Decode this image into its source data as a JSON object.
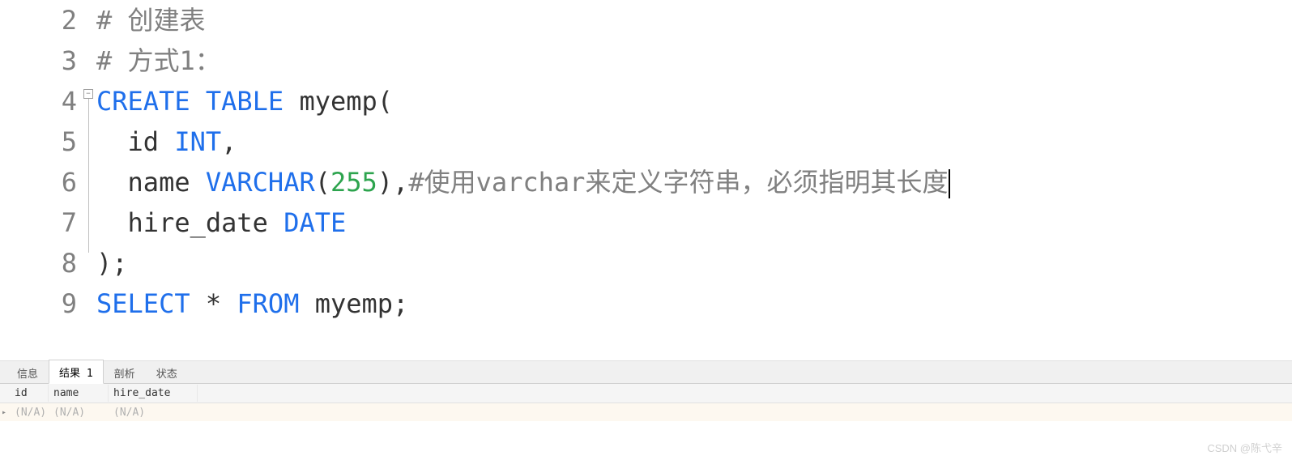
{
  "code": {
    "lines": [
      {
        "num": "2",
        "tokens": [
          {
            "cls": "tok-comment",
            "t": "# 创建表"
          }
        ]
      },
      {
        "num": "3",
        "tokens": [
          {
            "cls": "tok-comment",
            "t": "# 方式1："
          }
        ]
      },
      {
        "num": "4",
        "tokens": [
          {
            "cls": "tok-keyword",
            "t": "CREATE"
          },
          {
            "cls": "tok-punct",
            "t": " "
          },
          {
            "cls": "tok-keyword",
            "t": "TABLE"
          },
          {
            "cls": "tok-ident",
            "t": " myemp"
          },
          {
            "cls": "tok-punct",
            "t": "("
          }
        ]
      },
      {
        "num": "5",
        "tokens": [
          {
            "cls": "tok-punct",
            "t": "  "
          },
          {
            "cls": "tok-ident",
            "t": "id "
          },
          {
            "cls": "tok-keyword",
            "t": "INT"
          },
          {
            "cls": "tok-punct",
            "t": ","
          }
        ]
      },
      {
        "num": "6",
        "tokens": [
          {
            "cls": "tok-punct",
            "t": "  "
          },
          {
            "cls": "tok-ident",
            "t": "name "
          },
          {
            "cls": "tok-keyword",
            "t": "VARCHAR"
          },
          {
            "cls": "tok-punct",
            "t": "("
          },
          {
            "cls": "tok-number",
            "t": "255"
          },
          {
            "cls": "tok-punct",
            "t": "),"
          },
          {
            "cls": "tok-comment",
            "t": "#使用varchar来定义字符串，必须指明其长度"
          }
        ],
        "cursor": true
      },
      {
        "num": "7",
        "tokens": [
          {
            "cls": "tok-punct",
            "t": "  "
          },
          {
            "cls": "tok-ident",
            "t": "hire_date "
          },
          {
            "cls": "tok-keyword",
            "t": "DATE"
          }
        ]
      },
      {
        "num": "8",
        "tokens": [
          {
            "cls": "tok-punct",
            "t": ");"
          }
        ]
      },
      {
        "num": "9",
        "tokens": [
          {
            "cls": "tok-keyword",
            "t": "SELECT"
          },
          {
            "cls": "tok-punct",
            "t": " * "
          },
          {
            "cls": "tok-keyword",
            "t": "FROM"
          },
          {
            "cls": "tok-ident",
            "t": " myemp"
          },
          {
            "cls": "tok-punct",
            "t": ";"
          }
        ]
      }
    ],
    "fold_glyph": "−"
  },
  "tabs": {
    "items": [
      {
        "label": "信息",
        "active": false
      },
      {
        "label": "结果 1",
        "active": true
      },
      {
        "label": "剖析",
        "active": false
      },
      {
        "label": "状态",
        "active": false
      }
    ]
  },
  "results": {
    "columns": [
      {
        "key": "id",
        "label": "id"
      },
      {
        "key": "name",
        "label": "name"
      },
      {
        "key": "hire_date",
        "label": "hire_date"
      }
    ],
    "row_indicator": "▸",
    "rows": [
      {
        "id": "(N/A)",
        "name": "(N/A)",
        "hire_date": "(N/A)"
      }
    ]
  },
  "watermark": "CSDN @陈弋辛"
}
